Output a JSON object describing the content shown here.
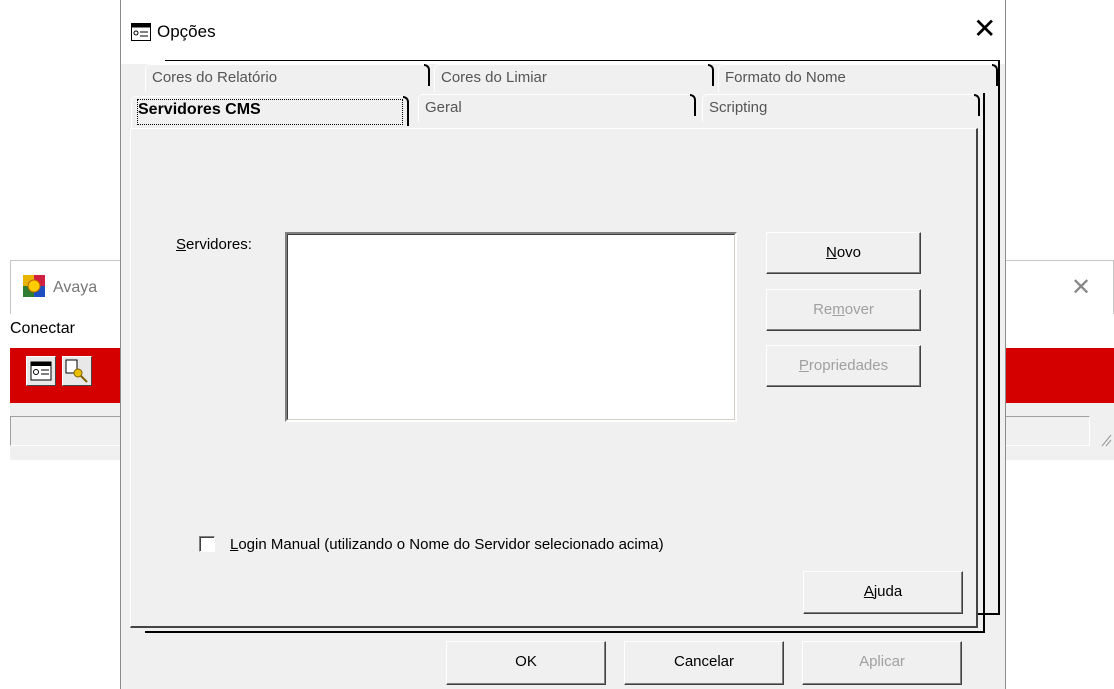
{
  "background_app": {
    "title": "Avaya",
    "menu": [
      "Conectar"
    ],
    "toolbar_icons": [
      "options-icon",
      "key-connect-icon"
    ]
  },
  "dialog": {
    "title": "Opções",
    "tabs_row1": [
      "Cores do Relatório",
      "Cores do Limiar",
      "Formato do Nome"
    ],
    "tabs_row2": [
      "Servidores CMS",
      "Geral",
      "Scripting"
    ],
    "active_tab": "Servidores CMS",
    "servers_label_u": "S",
    "servers_label_rest": "ervidores:",
    "buttons": {
      "novo_u": "N",
      "novo_rest": "ovo",
      "remover_a": "Re",
      "remover_u": "m",
      "remover_b": "over",
      "propriedades_u": "P",
      "propriedades_rest": "ropriedades"
    },
    "checkbox_u": "L",
    "checkbox_rest": "ogin Manual (utilizando o Nome do Servidor selecionado acima)",
    "checkbox_checked": false,
    "help_a": "",
    "help_u": "A",
    "help_b": "juda",
    "ok_label": "OK",
    "cancel_label": "Cancelar",
    "apply_label": "Aplicar",
    "servers": []
  }
}
